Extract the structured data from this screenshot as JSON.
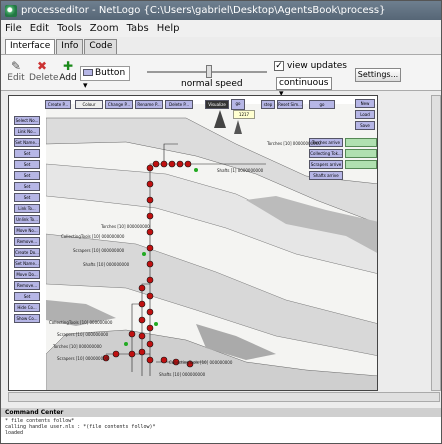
{
  "window": {
    "title": "processeditor - NetLogo {C:\\Users\\gabriel\\Desktop\\AgentsBook\\process}"
  },
  "menu": [
    "File",
    "Edit",
    "Tools",
    "Zoom",
    "Tabs",
    "Help"
  ],
  "tabs": [
    "Interface",
    "Info",
    "Code"
  ],
  "toolbar": {
    "edit_label": "Edit",
    "delete_label": "Delete",
    "add_label": "Add",
    "widget_type": "Button",
    "speed_label": "normal speed",
    "view_updates_label": "view updates",
    "view_updates_checked": true,
    "update_mode": "continuous",
    "settings_label": "Settings..."
  },
  "interface": {
    "top_buttons": [
      "Create P...",
      "Colour Shelf...",
      "Change P...",
      "Rename P...",
      "Delete P...",
      "Visualize",
      "go",
      "step",
      "Reset Sim...",
      "go"
    ],
    "left_buttons": [
      "Select No...",
      "Link No...",
      "Set Name...",
      "Set Action...",
      "Set Shape...",
      "Set Colour...",
      "Set Colour...",
      "Set Colour...",
      "Link To...",
      "Unlink To...",
      "Move No...",
      "Remove...",
      "Create Do...",
      "Set Name...",
      "Move Do...",
      "Remove...",
      "Set Colour...",
      "Hide Co...",
      "Show Co..."
    ],
    "right_buttons": [
      "New",
      "Load",
      "Save",
      "Torches arrive",
      "Collecting Tok...",
      "Scrapers arrive",
      "Shafts arrive"
    ],
    "tick_counter": "1217",
    "monitors": [
      "Torches [10] 00000000000",
      "Shafts [1] 0000000000",
      "CollectingTools [10] 000000000",
      "Torches [10] 000000000",
      "Scrapers [10] 000000000",
      "Shafts [10] 000000000",
      "CollectingTools [10] 000000000",
      "Scrapers [10] 000000000",
      "Torches [10] 000000000",
      "Scrapers [10] 000000000",
      "CollectingTools [10] 000000000",
      "Shafts [10] 000000000"
    ]
  },
  "command_center": {
    "label": "Command Center",
    "output": [
      "* file contents follow*",
      "calling handle user.nls : *(file contents follow)*",
      "loaded"
    ]
  },
  "colors": {
    "button_fill": "#b6b6e6",
    "monitor_fill": "#b0e0b0",
    "node_red": "#c01010"
  }
}
